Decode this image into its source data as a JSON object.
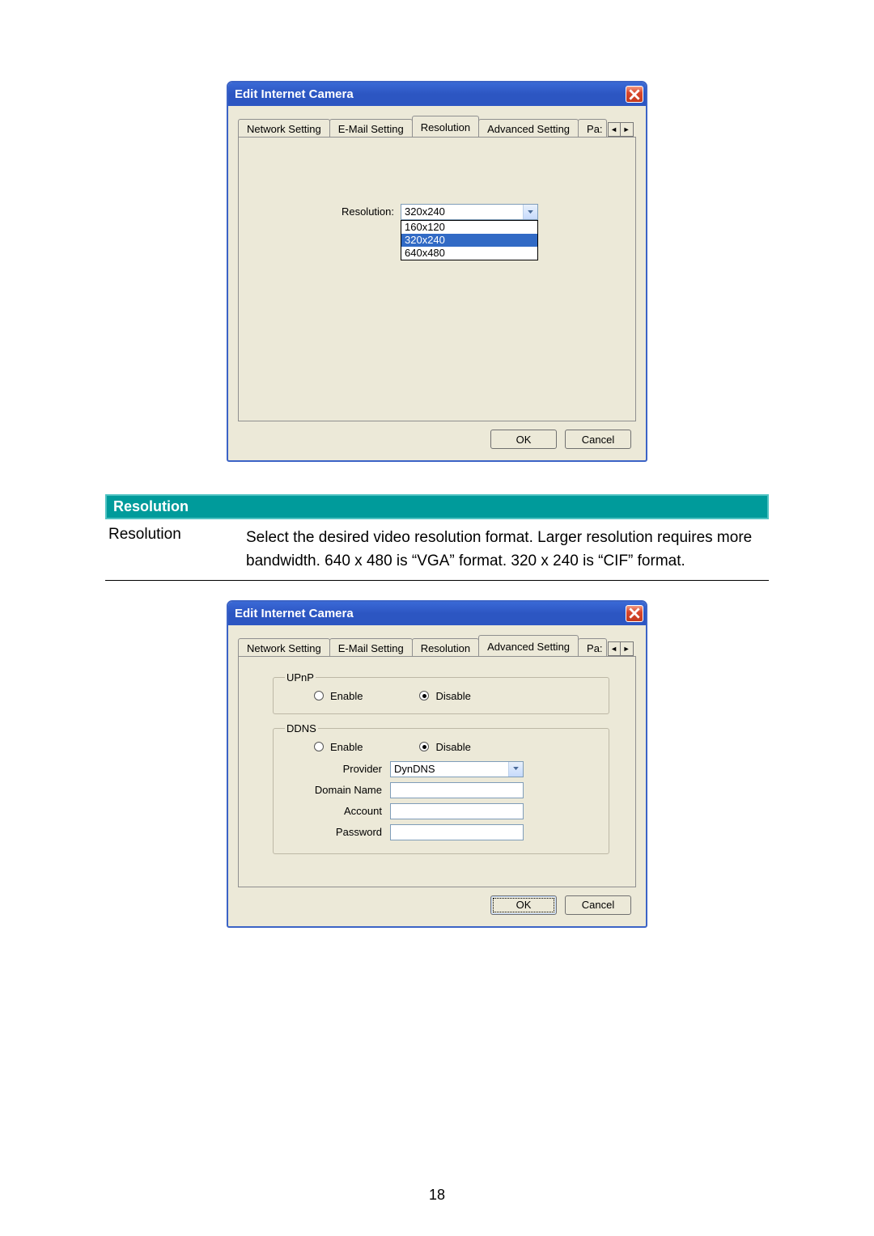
{
  "dialog1": {
    "title": "Edit Internet Camera",
    "tabs": [
      "Network Setting",
      "E-Mail Setting",
      "Resolution",
      "Advanced Setting"
    ],
    "truncated_tab": "Pa:",
    "selected_tab_index": 2,
    "resolution_label": "Resolution:",
    "combo_value": "320x240",
    "combo_options": [
      "160x120",
      "320x240",
      "640x480"
    ],
    "combo_selected_index": 1,
    "ok": "OK",
    "cancel": "Cancel"
  },
  "section": {
    "heading": "Resolution",
    "key": "Resolution",
    "desc": "Select the desired video resolution format. Larger resolution requires more bandwidth. 640 x 480 is “VGA” format. 320 x 240 is “CIF” format."
  },
  "dialog2": {
    "title": "Edit Internet Camera",
    "tabs": [
      "Network Setting",
      "E-Mail Setting",
      "Resolution",
      "Advanced Setting"
    ],
    "truncated_tab": "Pa:",
    "selected_tab_index": 3,
    "upnp": {
      "legend": "UPnP",
      "enable": "Enable",
      "disable": "Disable",
      "selected": "disable"
    },
    "ddns": {
      "legend": "DDNS",
      "enable": "Enable",
      "disable": "Disable",
      "selected": "disable",
      "provider_label": "Provider",
      "provider_value": "DynDNS",
      "domain_label": "Domain Name",
      "domain_value": "",
      "account_label": "Account",
      "account_value": "",
      "password_label": "Password",
      "password_value": ""
    },
    "ok": "OK",
    "cancel": "Cancel"
  },
  "page_number": "18",
  "icons": {
    "close": "close-icon",
    "dropdown": "chevron-down-icon",
    "scroll_left": "chevron-left-icon",
    "scroll_right": "chevron-right-icon"
  }
}
